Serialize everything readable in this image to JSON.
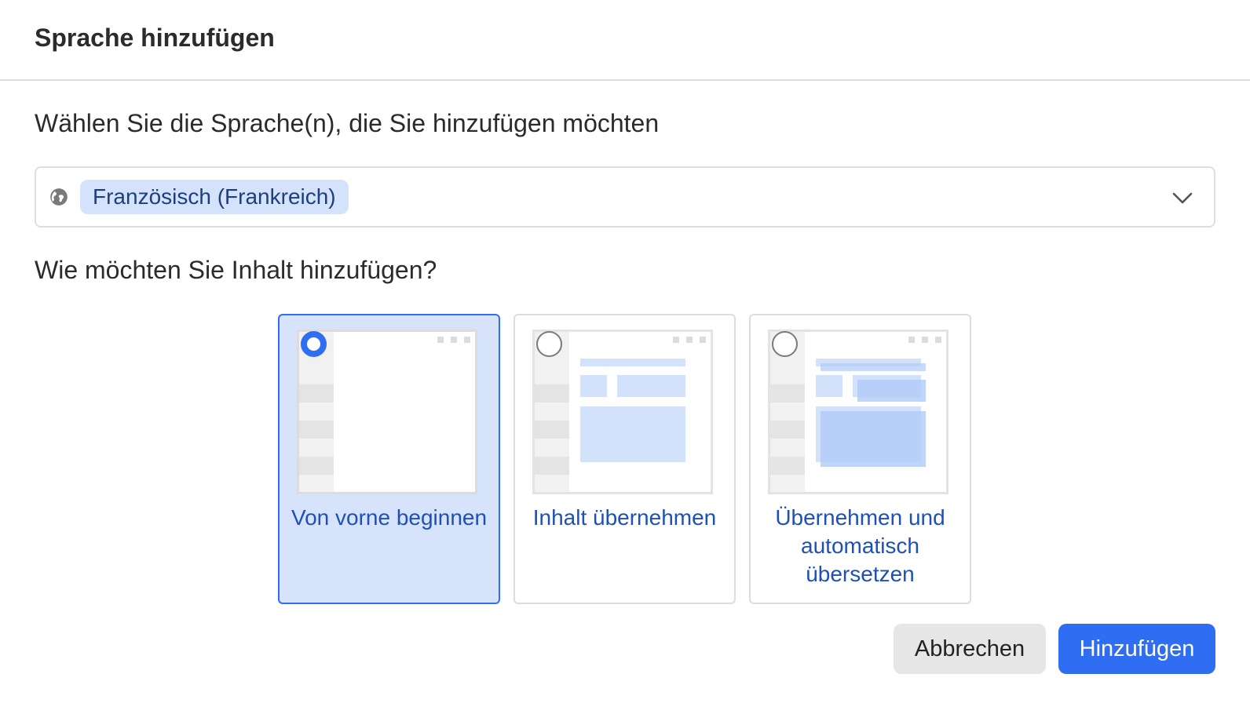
{
  "dialog": {
    "title": "Sprache hinzufügen"
  },
  "language_section": {
    "question": "Wählen Sie die Sprache(n), die Sie hinzufügen möchten",
    "selected_languages": [
      "Französisch (Frankreich)"
    ],
    "leading_icon": "globe-icon",
    "trailing_icon": "chevron-down-icon"
  },
  "content_section": {
    "question": "Wie möchten Sie Inhalt hinzufügen?",
    "selected_option": 0,
    "options": [
      {
        "label": "Von vorne beginnen",
        "selected": true
      },
      {
        "label": "Inhalt übernehmen",
        "selected": false
      },
      {
        "label": "Übernehmen und automatisch übersetzen",
        "selected": false
      }
    ]
  },
  "footer": {
    "cancel_label": "Abbrechen",
    "add_label": "Hinzufügen"
  },
  "colors": {
    "accent": "#2f6ef2",
    "selected_card_bg": "#d6e3fb",
    "chip_bg": "#d4e2fb",
    "option_text": "#1e50b8"
  }
}
